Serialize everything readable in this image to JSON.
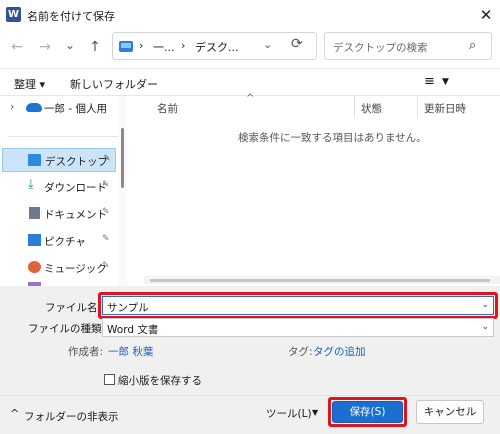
{
  "window": {
    "app_badge": "W",
    "title": "名前を付けて保存"
  },
  "nav": {
    "back": "←",
    "forward": "→",
    "recent": "⌄",
    "up": "↑",
    "address_sep1": "›",
    "address_part1": "一...",
    "address_sep2": "›",
    "address_part2": "デスク...",
    "address_chevron": "⌄",
    "refresh": "⟳",
    "search_placeholder": "デスクトップの検索"
  },
  "toolbar": {
    "organize": "整理 ▾",
    "new_folder": "新しいフォルダー",
    "view_icon": "≡",
    "view_chevron": "▼"
  },
  "sidebar": {
    "items": [
      {
        "label": "一郎 - 個人用",
        "expander": "›",
        "pinned": false,
        "selected": false,
        "icon": "cloud-icon"
      },
      {
        "label": "デスクトップ",
        "pinned": true,
        "selected": true,
        "icon": "desktop-icon"
      },
      {
        "label": "ダウンロード",
        "pinned": true,
        "selected": false,
        "icon": "download-icon"
      },
      {
        "label": "ドキュメント",
        "pinned": true,
        "selected": false,
        "icon": "document-icon"
      },
      {
        "label": "ピクチャ",
        "pinned": true,
        "selected": false,
        "icon": "picture-icon"
      },
      {
        "label": "ミュージック",
        "pinned": true,
        "selected": false,
        "icon": "music-icon"
      }
    ],
    "pin_glyph": "📌"
  },
  "filelist": {
    "columns": [
      "名前",
      "状態",
      "更新日時"
    ],
    "sort_caret": "^",
    "empty_message": "検索条件に一致する項目はありません。"
  },
  "form": {
    "filename_label": "ファイル名(N):",
    "filename_value": "サンプル",
    "filetype_label": "ファイルの種類(T):",
    "filetype_value": "Word 文書",
    "author_label": "作成者:",
    "author_value": "一郎 秋葉",
    "tags_label": "タグ:",
    "tags_value": "タグの追加",
    "thumbnail_label": "縮小版を保存する",
    "dropdown_glyph": "⌄"
  },
  "footer": {
    "hide_folders": "フォルダーの非表示",
    "hide_folders_caret": "^",
    "tools": "ツール(L)",
    "tools_caret": "▼",
    "save": "保存(S)",
    "cancel": "キャンセル"
  },
  "colors": {
    "accent": "#1a6fd1",
    "highlight_box": "#e0141e",
    "selection": "#cce4f7"
  }
}
